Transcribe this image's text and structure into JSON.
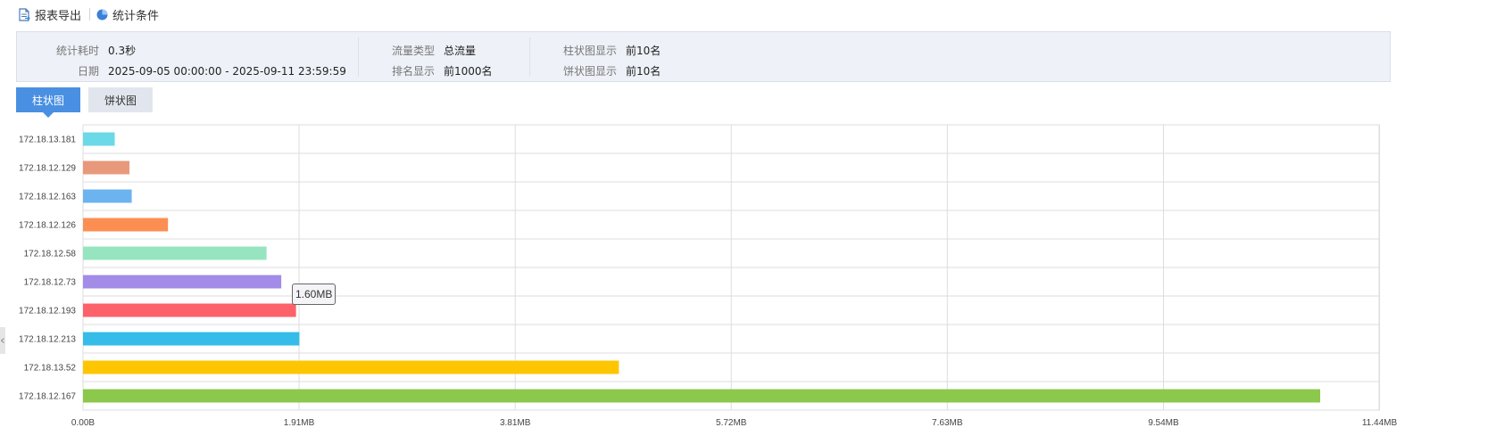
{
  "toolbar": {
    "export_label": "报表导出",
    "export_icon": "export-report-icon",
    "stats_label": "统计条件",
    "stats_icon": "pie-chart-icon"
  },
  "info": {
    "time_label": "统计耗时",
    "time_value": "0.3秒",
    "date_label": "日期",
    "date_value": "2025-09-05 00:00:00 - 2025-09-11 23:59:59",
    "flow_type_label": "流量类型",
    "flow_type_value": "总流量",
    "rank_label": "排名显示",
    "rank_value": "前1000名",
    "bar_show_label": "柱状图显示",
    "bar_show_value": "前10名",
    "pie_show_label": "饼状图显示",
    "pie_show_value": "前10名"
  },
  "tabs": [
    {
      "label": "柱状图",
      "active": true
    },
    {
      "label": "饼状图",
      "active": false
    }
  ],
  "tooltip": {
    "text": "1.60MB"
  },
  "chart_data": {
    "type": "bar",
    "orientation": "horizontal",
    "title": "",
    "xlabel": "",
    "ylabel": "",
    "xlim": [
      0,
      11.44
    ],
    "unit": "MB",
    "grid": true,
    "x_ticks": [
      0,
      1.907,
      3.815,
      5.722,
      7.629,
      9.537,
      11.444
    ],
    "x_tick_labels": [
      "0.00B",
      "1.91MB",
      "3.81MB",
      "5.72MB",
      "7.63MB",
      "9.54MB",
      "11.44MB"
    ],
    "categories": [
      "172.18.13.181",
      "172.18.12.129",
      "172.18.12.163",
      "172.18.12.126",
      "172.18.12.58",
      "172.18.12.73",
      "172.18.12.193",
      "172.18.12.213",
      "172.18.13.52",
      "172.18.12.167"
    ],
    "values": [
      0.28,
      0.41,
      0.43,
      0.75,
      1.62,
      1.75,
      1.88,
      1.91,
      4.73,
      10.92
    ],
    "colors": [
      "#6bd9e8",
      "#e8997c",
      "#6cb4f0",
      "#fd8e52",
      "#97e5c0",
      "#a38be8",
      "#fd6169",
      "#35bce9",
      "#fec602",
      "#8cc84b"
    ]
  }
}
